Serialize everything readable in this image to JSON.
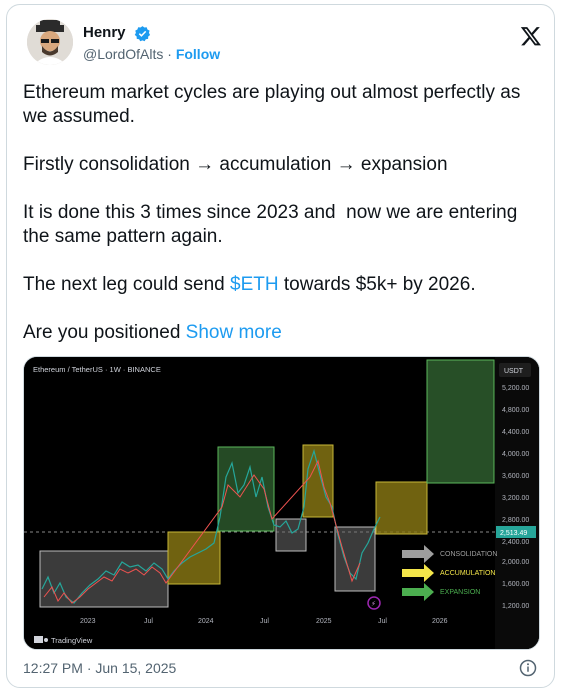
{
  "author": {
    "name": "Henry",
    "handle": "@LordOfAlts",
    "separator": "·",
    "follow_label": "Follow"
  },
  "tweet": {
    "p1": "Ethereum market cycles are playing out almost perfectly as we assumed.",
    "p2": "Firstly consolidation → accumulation → expansion",
    "p3": "It is done this 3 times since 2023 and  now we are entering the same pattern again.",
    "p4_before": "The next leg could send ",
    "p4_cashtag": "$ETH",
    "p4_after": " towards $5k+ by 2026.",
    "p5": "Are you positioned ",
    "show_more": "Show more"
  },
  "chart": {
    "header": "Ethereum / TetherUS · 1W · BINANCE",
    "currency": "USDT",
    "price_ticks": [
      "5,200.00",
      "4,800.00",
      "4,400.00",
      "4,000.00",
      "3,600.00",
      "3,200.00",
      "2,800.00",
      "2,400.00",
      "2,000.00",
      "1,600.00",
      "1,200.00"
    ],
    "current_price": "2,513.49",
    "time_ticks": [
      "2023",
      "Jul",
      "2024",
      "Jul",
      "2025",
      "Jul",
      "2026"
    ],
    "legend": [
      "CONSOLIDATION",
      "ACCUMULATION",
      "EXPANSION"
    ],
    "legend_colors": [
      "#9e9e9e",
      "#f4e64a",
      "#4caf50"
    ],
    "watermark": "TradingView"
  },
  "footer": {
    "timestamp": "12:27 PM · Jun 15, 2025"
  }
}
